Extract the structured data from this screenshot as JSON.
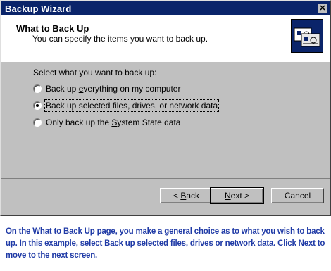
{
  "window": {
    "title": "Backup Wizard",
    "close_glyph": "✕"
  },
  "header": {
    "title": "What to Back Up",
    "subtitle": "You can specify the items you want to back up.",
    "icon": "backup-wizard-icon"
  },
  "body": {
    "prompt": "Select what you want to back up:",
    "options": [
      {
        "pre": "Back up ",
        "accel": "e",
        "post": "verything on my computer",
        "checked": false
      },
      {
        "pre": "Back up selected files, drives, or network data",
        "accel": "",
        "post": "",
        "checked": true
      },
      {
        "pre": "Only back up the ",
        "accel": "S",
        "post": "ystem State data",
        "checked": false
      }
    ]
  },
  "buttons": {
    "back": {
      "pre": "< ",
      "accel": "B",
      "post": "ack"
    },
    "next": {
      "pre": "",
      "accel": "N",
      "post": "ext >"
    },
    "cancel": "Cancel"
  },
  "caption": "On the What to Back Up page, you make a general choice as to what you wish to back up. In this example, select Back up selected files, drives or network data. Click Next to move to the next screen.",
  "colors": {
    "titlebar": "#0a246a",
    "face": "#c0c0c0",
    "caption_text": "#1f3aa6"
  }
}
